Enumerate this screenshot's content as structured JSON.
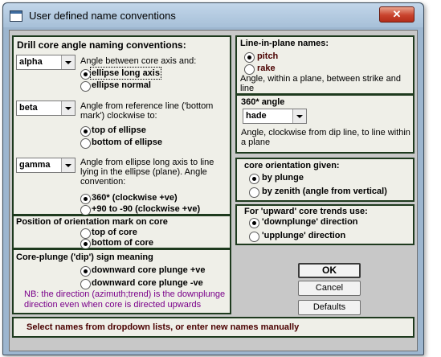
{
  "window": {
    "title": "User defined name conventions",
    "close_glyph": "✕"
  },
  "drill_core": {
    "title": "Drill core angle naming conventions:",
    "alpha": {
      "value": "alpha",
      "description": "Angle between core axis and:",
      "options": [
        "ellipse long axis",
        "ellipse normal"
      ],
      "selected": 0
    },
    "beta": {
      "value": "beta",
      "description": "Angle from reference line ('bottom mark') clockwise to:",
      "options": [
        "top of ellipse",
        "bottom of ellipse"
      ],
      "selected": 0
    },
    "gamma": {
      "value": "gamma",
      "description": "Angle from ellipse long axis to line lying in the ellipse (plane). Angle convention:",
      "options": [
        "360* (clockwise +ve)",
        "+90 to -90 (clockwise +ve)"
      ],
      "selected": 0
    }
  },
  "orientation_mark": {
    "title": "Position of orientation mark on core",
    "options": [
      "top of core",
      "bottom of core"
    ],
    "selected": 1
  },
  "core_plunge": {
    "title": "Core-plunge ('dip') sign meaning",
    "options": [
      "downward core plunge +ve",
      "downward core plunge -ve"
    ],
    "selected": 0,
    "note": "NB: the direction (azimuth;trend) is the downplunge direction even when core is directed upwards"
  },
  "line_in_plane": {
    "title": "Line-in-plane names:",
    "options": [
      "pitch",
      "rake"
    ],
    "selected": 0,
    "description": "Angle, within a plane, between strike and line"
  },
  "angle_360": {
    "title": "360* angle",
    "value": "hade",
    "description": "Angle, clockwise from dip line, to line within a plane"
  },
  "core_orientation": {
    "title": "core orientation given:",
    "options": [
      "by plunge",
      "by zenith (angle from vertical)"
    ],
    "selected": 0
  },
  "upward_trends": {
    "title": "For 'upward' core trends use:",
    "options": [
      "'downplunge' direction",
      "'upplunge' direction"
    ],
    "selected": 0
  },
  "buttons": {
    "ok": "OK",
    "cancel": "Cancel",
    "defaults": "Defaults"
  },
  "status": {
    "text": "Select names from dropdown lists, or enter new names manually"
  },
  "colors": {
    "title_bar": "#a7c0d8",
    "group_border": "#1e3a1e",
    "status_text": "#4a0000",
    "note_text": "#7a008a"
  }
}
